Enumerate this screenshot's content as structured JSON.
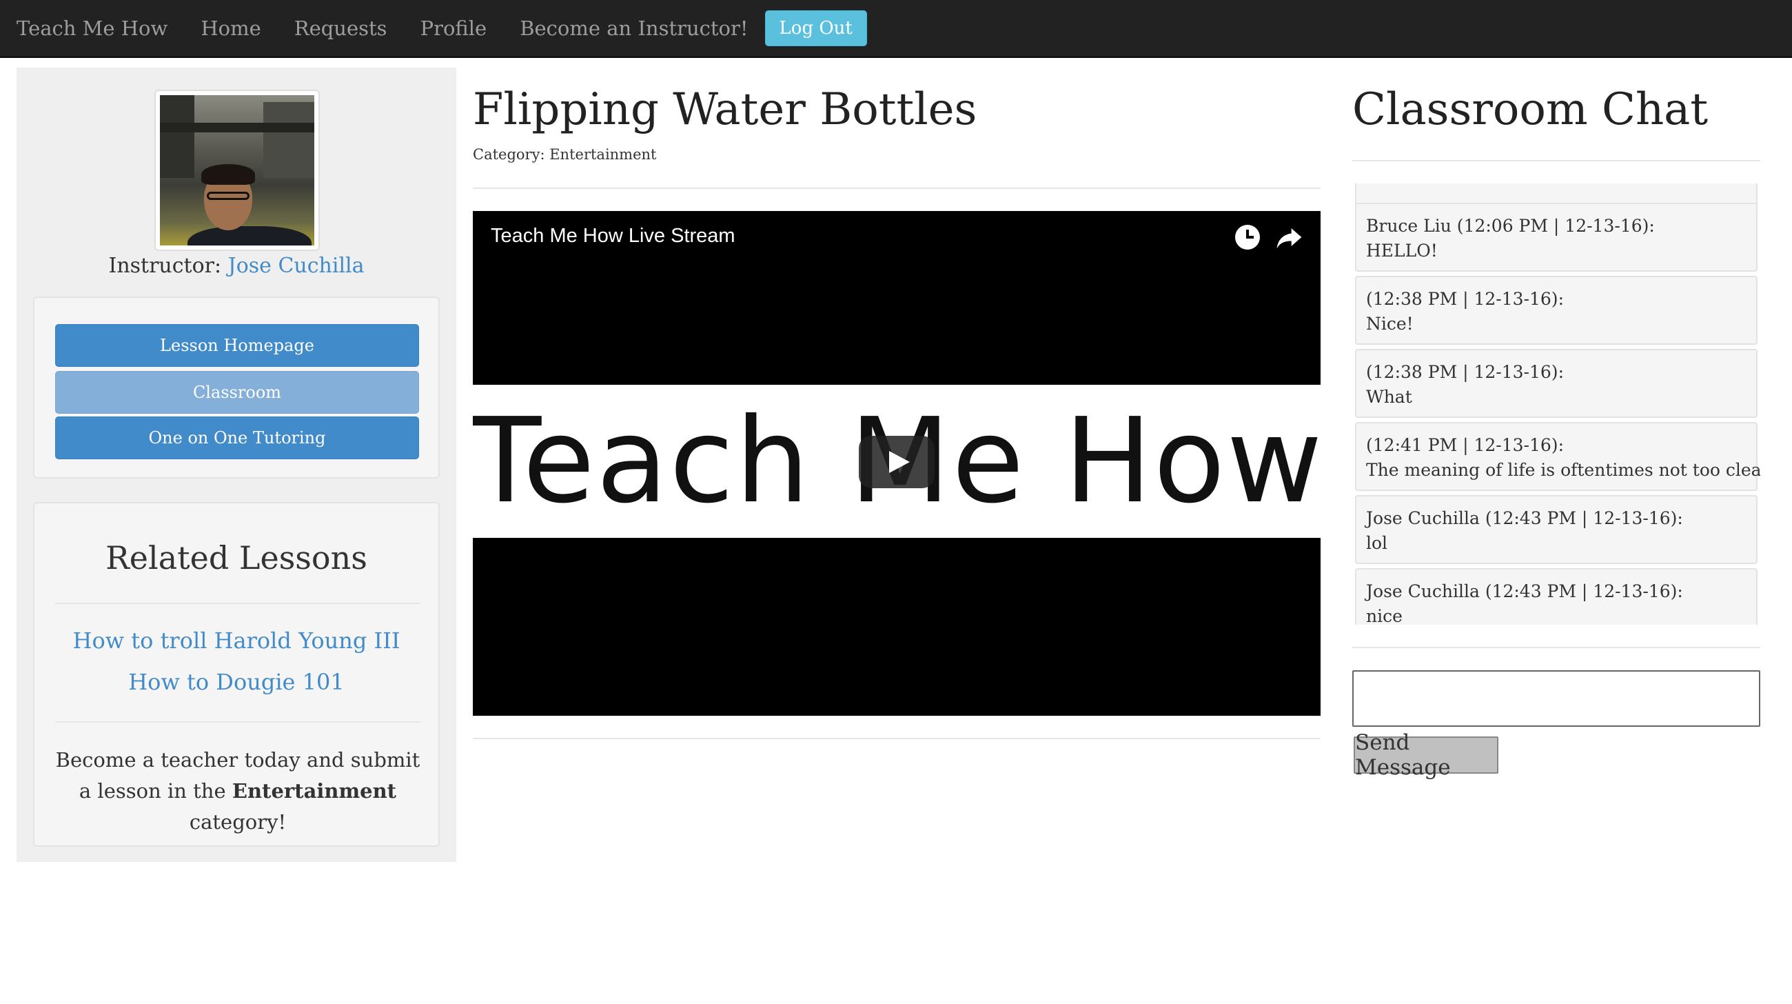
{
  "nav": {
    "brand": "Teach Me How",
    "items": [
      "Home",
      "Requests",
      "Profile",
      "Become an Instructor!"
    ],
    "logout": "Log Out"
  },
  "sidebar": {
    "instructor_label": "Instructor:",
    "instructor_name": "Jose Cuchilla",
    "buttons": [
      "Lesson Homepage",
      "Classroom",
      "One on One Tutoring"
    ],
    "active_button": "Classroom",
    "related_title": "Related Lessons",
    "related_lessons": [
      "How to troll Harold Young III",
      "How to Dougie 101"
    ],
    "promo_before": "Become a teacher today and submit a lesson in the",
    "promo_category": "Entertainment",
    "promo_after": "category!"
  },
  "lesson": {
    "title": "Flipping Water Bottles",
    "category_label": "Category:",
    "category": "Entertainment"
  },
  "video": {
    "title": "Teach Me How Live Stream",
    "logo_text": "Teach Me How"
  },
  "chat": {
    "title": "Classroom Chat",
    "messages": [
      {
        "header": "Bruce Liu (12:06 PM | 12-13-16):",
        "text": "HELLO!"
      },
      {
        "header": "(12:38 PM | 12-13-16):",
        "text": "Nice!"
      },
      {
        "header": "(12:38 PM | 12-13-16):",
        "text": "What"
      },
      {
        "header": "(12:41 PM | 12-13-16):",
        "text": "The meaning of life is oftentimes not too clear."
      },
      {
        "header": "Jose Cuchilla (12:43 PM | 12-13-16):",
        "text": "lol"
      },
      {
        "header": "Jose Cuchilla (12:43 PM | 12-13-16):",
        "text": "nice"
      }
    ],
    "input_value": "",
    "send_label": "Send Message"
  },
  "colors": {
    "navbar": "#222222",
    "link": "#428bca",
    "primary_button": "#428bca",
    "active_button": "#84afd9",
    "logout_button": "#5bc0de"
  }
}
